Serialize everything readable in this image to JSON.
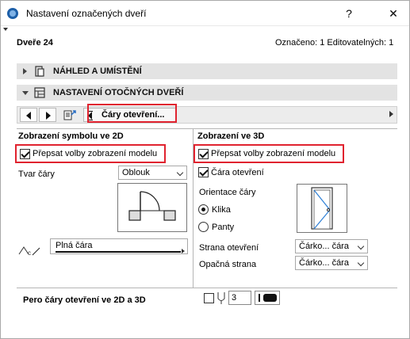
{
  "window": {
    "title": "Nastavení označených dveří",
    "help": "?",
    "close": "✕"
  },
  "header": {
    "element_name": "Dveře 24",
    "selection_info": "Označeno: 1 Editovatelných: 1"
  },
  "sections": [
    {
      "label": "NÁHLED A UMÍSTĚNÍ",
      "expanded": false
    },
    {
      "label": "NASTAVENÍ OTOČNÝCH DVEŘÍ",
      "expanded": true
    }
  ],
  "nav": {
    "page_label": "Čáry otevření..."
  },
  "left": {
    "heading": "Zobrazení symbolu ve 2D",
    "override_label": "Přepsat volby zobrazení modelu",
    "override_checked": true,
    "line_shape_label": "Tvar čáry",
    "line_shape_value": "Oblouk",
    "line_type_value": "Plná čára"
  },
  "right": {
    "heading": "Zobrazení ve 3D",
    "override_label": "Přepsat volby zobrazení modelu",
    "override_checked": true,
    "opening_line_label": "Čára otevření",
    "opening_line_checked": true,
    "orientation_label": "Orientace čáry",
    "radio_options": [
      "Klika",
      "Panty"
    ],
    "radio_selected": "Klika",
    "opening_side_label": "Strana otevření",
    "opening_side_value": "Čárko... čára",
    "opposite_side_label": "Opačná strana",
    "opposite_side_value": "Čárko... čára"
  },
  "footer": {
    "pen_label": "Pero čáry otevření ve 2D a 3D",
    "pen_value": "3"
  },
  "colors": {
    "highlight": "#e0232f",
    "section_bg": "#e3e3e3"
  }
}
